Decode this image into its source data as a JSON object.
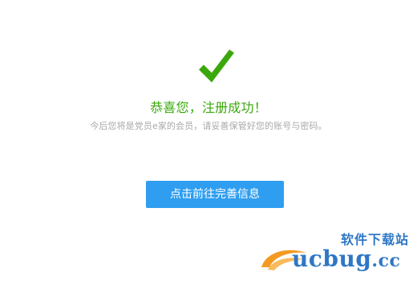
{
  "success": {
    "title": "恭喜您，注册成功！",
    "subtitle": "今后您将是党员e家的会员，请妥善保管好您的账号与密码。"
  },
  "actions": {
    "complete_profile_label": "点击前往完善信息"
  },
  "watermark": {
    "top_text": "软件下载站",
    "logo_text_main": "ucbug",
    "logo_text_suffix": ".cc"
  },
  "colors": {
    "success_green": "#3aa80b",
    "subtitle_gray": "#a9a9a9",
    "button_blue": "#2f9ef0",
    "watermark_blue": "#2f77c5",
    "watermark_orange": "#f39a22"
  },
  "icons": {
    "success": "check-icon"
  }
}
